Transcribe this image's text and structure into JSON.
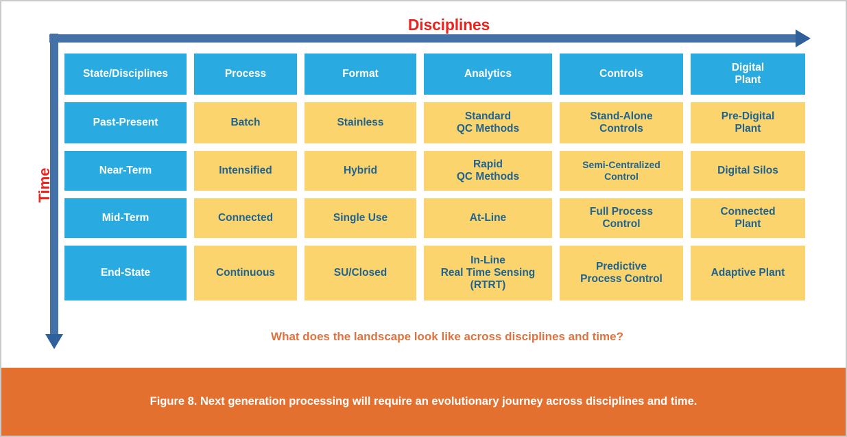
{
  "figure": {
    "x_axis_label": "Disciplines",
    "y_axis_label": "Time",
    "question": "What does the landscape look like across disciplines and time?",
    "caption": "Figure 8. Next generation processing will require an evolutionary journey across disciplines and time."
  },
  "colors": {
    "header_blue": "#29ABE2",
    "cell_yellow": "#FBD46D",
    "cell_text_blue": "#1F6390",
    "arrow_blue": "#4472A8",
    "arrow_head_blue": "#30609C",
    "axis_label_red": "#E8241F",
    "question_orange": "#DD7340",
    "caption_band_orange": "#E3702F",
    "caption_text": "#FFFFFF",
    "page_border_gray": "#C9CACC"
  },
  "chart_data": {
    "type": "table",
    "title": "Next generation processing evolution matrix",
    "xlabel": "Disciplines",
    "ylabel": "Time",
    "columns": [
      "State/Disciplines",
      "Process",
      "Format",
      "Analytics",
      "Controls",
      "Digital\nPlant"
    ],
    "rows": [
      {
        "state": "Past-Present",
        "cells": [
          "Batch",
          "Stainless",
          "Standard\nQC Methods",
          "Stand-Alone\nControls",
          "Pre-Digital\nPlant"
        ]
      },
      {
        "state": "Near-Term",
        "cells": [
          "Intensified",
          "Hybrid",
          "Rapid\nQC Methods",
          "Semi-Centralized\nControl",
          "Digital Silos"
        ]
      },
      {
        "state": "Mid-Term",
        "cells": [
          "Connected",
          "Single Use",
          "At-Line",
          "Full Process\nControl",
          "Connected\nPlant"
        ]
      },
      {
        "state": "End-State",
        "cells": [
          "Continuous",
          "SU/Closed",
          "In-Line\nReal Time Sensing\n(RTRT)",
          "Predictive\nProcess Control",
          "Adaptive Plant"
        ]
      }
    ]
  }
}
